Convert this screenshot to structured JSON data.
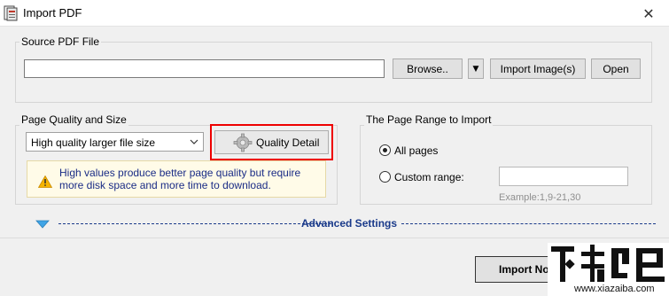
{
  "window": {
    "title": "Import PDF",
    "close_glyph": "✕"
  },
  "source": {
    "group_label": "Source PDF File",
    "path_value": "",
    "browse_label": "Browse..",
    "dropdown_glyph": "▼",
    "import_image_label": "Import Image(s)",
    "open_label": "Open"
  },
  "quality": {
    "group_label": "Page Quality and Size",
    "selected": "High quality larger file size",
    "detail_button_label": "Quality Detail",
    "info_text": "High values produce better page quality but require more disk space and more time to download."
  },
  "range": {
    "group_label": "The Page Range to Import",
    "all_pages_label": "All pages",
    "custom_range_label": "Custom range:",
    "custom_range_value": "",
    "example_text": "Example:1,9-21,30",
    "selected": "all"
  },
  "advanced": {
    "label": "Advanced Settings"
  },
  "footer": {
    "import_label": "Import Now"
  },
  "watermark": {
    "site_text": "www.xiazaiba.com"
  },
  "colors": {
    "accent_blue": "#1a3a8a",
    "info_text": "#1a2c86",
    "highlight_red": "#e00000",
    "arrow_blue": "#3fa4e6"
  }
}
